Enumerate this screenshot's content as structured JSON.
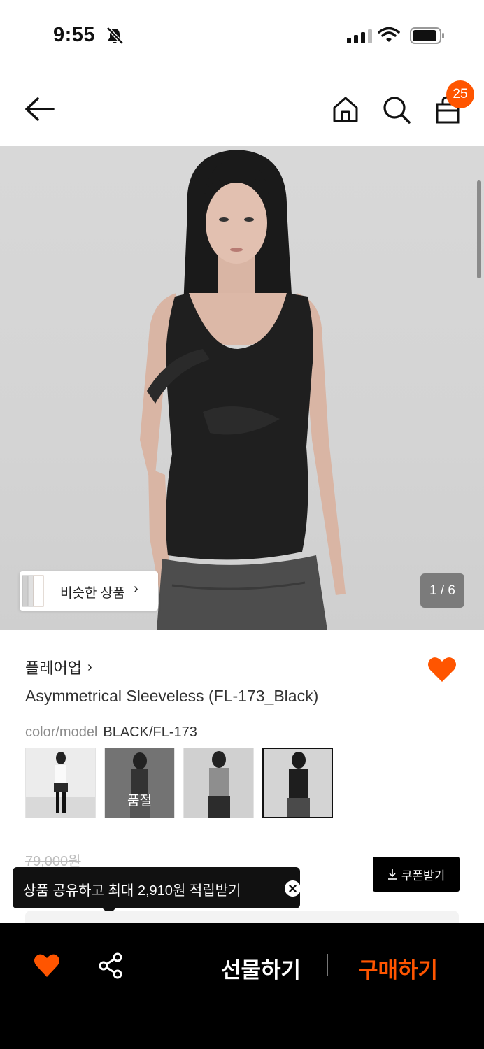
{
  "status_bar": {
    "time": "9:55",
    "icons": [
      "bell-slash-icon",
      "cellular-signal-icon",
      "wifi-icon",
      "battery-icon"
    ]
  },
  "nav": {
    "cart_count": "25",
    "icons": [
      "back-arrow-icon",
      "home-icon",
      "search-icon",
      "shopping-bag-icon"
    ]
  },
  "gallery": {
    "similar_label": "비슷한 상품",
    "similar_chevron": "›",
    "page_counter": "1 / 6"
  },
  "product": {
    "brand": "플레어업",
    "brand_chevron": "›",
    "title": "Asymmetrical Sleeveless (FL-173_Black)",
    "option_label": "color/model",
    "option_value": "BLACK/FL-173",
    "variants": [
      {
        "label": ""
      },
      {
        "label": "품절"
      },
      {
        "label": ""
      },
      {
        "label": ""
      }
    ],
    "original_price": "79,000원",
    "coupon_label": "쿠폰받기",
    "accent_color": "#ff5500"
  },
  "tooltip": {
    "text": "상품 공유하고 최대 2,910원 적립받기"
  },
  "bottom_bar": {
    "gift_label": "선물하기",
    "buy_label": "구매하기"
  }
}
